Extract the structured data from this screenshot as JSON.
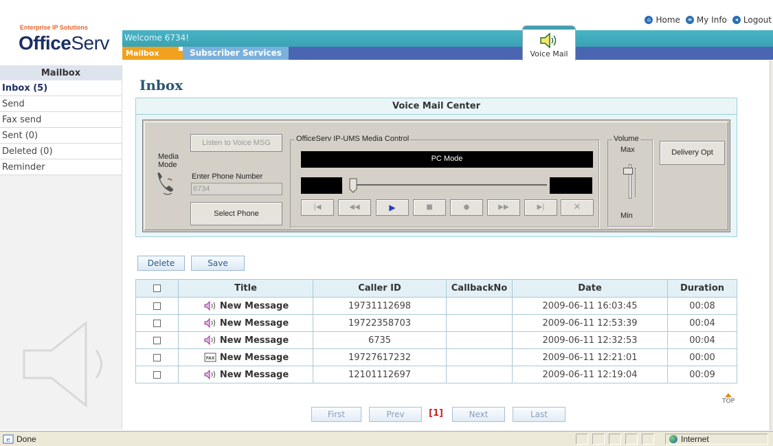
{
  "brand": {
    "tagline": "Enterprise IP Solutions",
    "logo_bold": "Office",
    "logo_light": "Serv"
  },
  "top_links": {
    "home": "Home",
    "my_info": "My Info",
    "logout": "Logout"
  },
  "header": {
    "welcome": "Welcome 6734!",
    "tab_mailbox": "Mailbox",
    "tab_subscriber": "Subscriber Services",
    "voicemail_label": "Voice Mail"
  },
  "sidebar": {
    "title": "Mailbox",
    "items": [
      {
        "label": "Inbox (5)",
        "active": true
      },
      {
        "label": "Send"
      },
      {
        "label": "Fax send"
      },
      {
        "label": "Sent (0)"
      },
      {
        "label": "Deleted (0)"
      },
      {
        "label": "Reminder"
      }
    ]
  },
  "main": {
    "title": "Inbox"
  },
  "vmc": {
    "title": "Voice Mail Center",
    "media_mode_label_1": "Media",
    "media_mode_label_2": "Mode",
    "listen_button": "Listen to Voice MSG",
    "phone_label": "Enter Phone Number",
    "phone_value": "6734",
    "select_phone_button": "Select Phone",
    "media_control_caption": "OfficeServ IP-UMS Media Control",
    "mode_display": "PC Mode",
    "volume_caption": "Volume",
    "volume_max": "Max",
    "volume_min": "Min",
    "delivery_button": "Delivery Opt"
  },
  "actions": {
    "delete": "Delete",
    "save": "Save"
  },
  "table": {
    "headers": [
      "Title",
      "Caller ID",
      "CallbackNo",
      "Date",
      "Duration"
    ],
    "rows": [
      {
        "type": "voice",
        "title": "New Message",
        "caller": "19731112698",
        "callback": "",
        "date": "2009-06-11 16:03:45",
        "duration": "00:08"
      },
      {
        "type": "voice",
        "title": "New Message",
        "caller": "19722358703",
        "callback": "",
        "date": "2009-06-11 12:53:39",
        "duration": "00:04"
      },
      {
        "type": "voice",
        "title": "New Message",
        "caller": "6735",
        "callback": "",
        "date": "2009-06-11 12:32:53",
        "duration": "00:04"
      },
      {
        "type": "fax",
        "title": "New Message",
        "caller": "19727617232",
        "callback": "",
        "date": "2009-06-11 12:21:01",
        "duration": "00:00"
      },
      {
        "type": "voice",
        "title": "New Message",
        "caller": "12101112697",
        "callback": "",
        "date": "2009-06-11 12:19:04",
        "duration": "00:09"
      }
    ]
  },
  "pagination": {
    "first": "First",
    "prev": "Prev",
    "current": "[1]",
    "next": "Next",
    "last": "Last"
  },
  "top_link": "TOP",
  "statusbar": {
    "done": "Done",
    "zone": "Internet"
  }
}
